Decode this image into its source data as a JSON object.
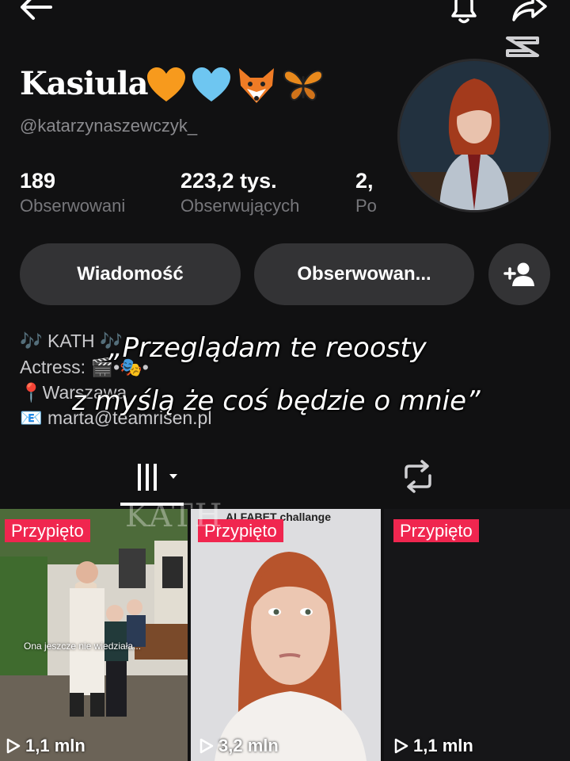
{
  "profile": {
    "display_name": "Kasiula",
    "username": "@katarzynaszewczyk_",
    "name_emojis": [
      "orange-heart",
      "light-blue-heart",
      "fox",
      "butterfly"
    ]
  },
  "stats": [
    {
      "value": "189",
      "label": "Obserwowani"
    },
    {
      "value": "223,2 tys.",
      "label": "Obserwujących"
    },
    {
      "value": "2,",
      "label": "Po"
    }
  ],
  "actions": {
    "message_label": "Wiadomość",
    "following_label": "Obserwowan...",
    "add_friend_icon": "add-user-icon"
  },
  "bio": {
    "line1": "🎶 KATH 🎶",
    "line2": "Actress: 🎬•🎭•",
    "line3": "📍Warszawa",
    "line4": "📧 marta@teamrisen.pl"
  },
  "overlay_caption": {
    "line1": "„Przeglądam te reoosty",
    "line2": "z myślą że coś będzie o mnie”"
  },
  "tabs": {
    "videos_icon": "grid-icon",
    "reposts_icon": "repost-icon"
  },
  "videos": [
    {
      "pinned_label": "Przypięto",
      "views": "1,1 mln",
      "caption_overlay": "Ona jeszcze nie wiedziała..."
    },
    {
      "pinned_label": "Przypięto",
      "views": "3,2 mln",
      "caption_overlay": "ALFABET challange"
    },
    {
      "pinned_label": "Przypięto",
      "views": "1,1 mln"
    }
  ],
  "watermark": {
    "text": "KATH"
  },
  "colors": {
    "background": "#111112",
    "pinned_badge": "#f0264f",
    "button": "#333335",
    "secondary_text": "#77777b"
  }
}
